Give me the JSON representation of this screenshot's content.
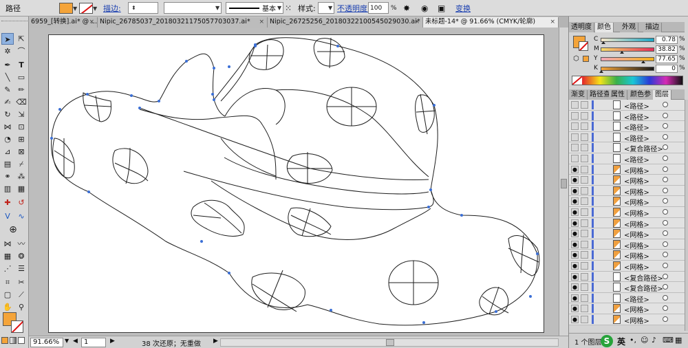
{
  "control_bar": {
    "object_type": "路径",
    "stroke_label": "描边:",
    "stroke_profile": "基本",
    "style_label": "样式:",
    "opacity_label": "不透明度:",
    "opacity_value": "100",
    "opacity_unit": "%",
    "transform_label": "变换",
    "fill_color": "#f4a43a"
  },
  "tabs": [
    {
      "label": "6959_[转换].ai* @ ...",
      "active": false
    },
    {
      "label": "Nipic_26785037_20180321175057703037.ai*",
      "active": false
    },
    {
      "label": "Nipic_26725256_20180322100545029030.ai*",
      "active": false
    },
    {
      "label": "未标题-14* @ 91.66% (CMYK/轮廓)",
      "active": true
    }
  ],
  "tab_close_glyph": "×",
  "status_bar": {
    "zoom": "91.66%",
    "page": "1",
    "history": "38 次还原；无重做"
  },
  "color_panel": {
    "tabs": [
      "透明度",
      "颜色",
      "外观",
      "描边"
    ],
    "active_tab": "颜色",
    "channels": [
      {
        "label": "C",
        "value": "0.78"
      },
      {
        "label": "M",
        "value": "38.82"
      },
      {
        "label": "Y",
        "value": "77.65"
      },
      {
        "label": "K",
        "value": "0"
      }
    ],
    "unit": "%",
    "fill_color": "#f4a43a"
  },
  "layers_panel": {
    "tabs": [
      "渐变",
      "路径查",
      "属性",
      "颜色参",
      "图层"
    ],
    "active_tab": "图层",
    "rows": [
      {
        "label": "<路径>",
        "visible": false,
        "mesh": false
      },
      {
        "label": "<路径>",
        "visible": false,
        "mesh": false
      },
      {
        "label": "<路径>",
        "visible": false,
        "mesh": false
      },
      {
        "label": "<路径>",
        "visible": false,
        "mesh": false
      },
      {
        "label": "<复合路径>",
        "visible": false,
        "mesh": false
      },
      {
        "label": "<路径>",
        "visible": false,
        "mesh": false
      },
      {
        "label": "<网格>",
        "visible": true,
        "mesh": true
      },
      {
        "label": "<网格>",
        "visible": true,
        "mesh": true
      },
      {
        "label": "<网格>",
        "visible": true,
        "mesh": true
      },
      {
        "label": "<网格>",
        "visible": true,
        "mesh": true
      },
      {
        "label": "<网格>",
        "visible": true,
        "mesh": true
      },
      {
        "label": "<网格>",
        "visible": true,
        "mesh": true
      },
      {
        "label": "<网格>",
        "visible": true,
        "mesh": true
      },
      {
        "label": "<网格>",
        "visible": true,
        "mesh": true
      },
      {
        "label": "<网格>",
        "visible": true,
        "mesh": true
      },
      {
        "label": "<网格>",
        "visible": true,
        "mesh": true
      },
      {
        "label": "<复合路径>",
        "visible": true,
        "mesh": false
      },
      {
        "label": "<复合路径>",
        "visible": true,
        "mesh": false
      },
      {
        "label": "<路径>",
        "visible": true,
        "mesh": false
      },
      {
        "label": "<网格>",
        "visible": true,
        "mesh": true
      },
      {
        "label": "<网格>",
        "visible": true,
        "mesh": true
      }
    ],
    "footer": "1 个图层"
  },
  "ime": {
    "brand": "S",
    "mode": "英"
  }
}
